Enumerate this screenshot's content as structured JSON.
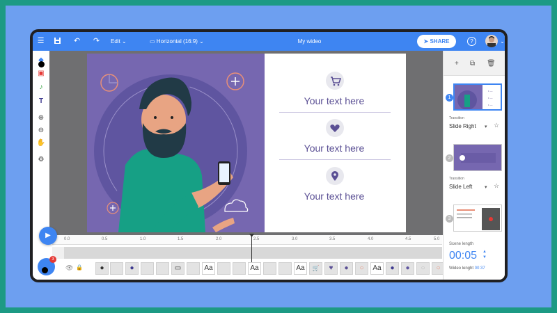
{
  "app": {
    "title": "My wideo",
    "menu_edit": "Edit",
    "aspect": "Horizontal (16:9)",
    "share": "SHARE"
  },
  "slide": {
    "texts": [
      "Your text here",
      "Your text here",
      "Your text here"
    ],
    "icons": [
      "cart-icon",
      "heart-icon",
      "location-pin-icon"
    ]
  },
  "scenes": [
    {
      "num": "1",
      "transition_label": "Transition",
      "transition": "Slide Right"
    },
    {
      "num": "2",
      "transition_label": "Transition",
      "transition": "Slide Left"
    },
    {
      "num": "3"
    }
  ],
  "timeline": {
    "ticks": [
      "0.0",
      "0.5",
      "1.0",
      "1.5",
      "2.0",
      "2.5",
      "3.0",
      "3.5",
      "4.0",
      "4.5",
      "5.0"
    ],
    "playhead_seconds": 2.5,
    "layer_text": "Aa"
  },
  "scene_length": {
    "label": "Scene length",
    "value": "00:05",
    "video_length_label": "Wideo lenght",
    "video_length": "00:37"
  },
  "badge": "3",
  "colors": {
    "primary": "#3e85f2",
    "slide_purple": "#7667b0",
    "text_purple": "#5a4f94",
    "background": "#1d9a84",
    "frame": "#6d9ff0"
  }
}
